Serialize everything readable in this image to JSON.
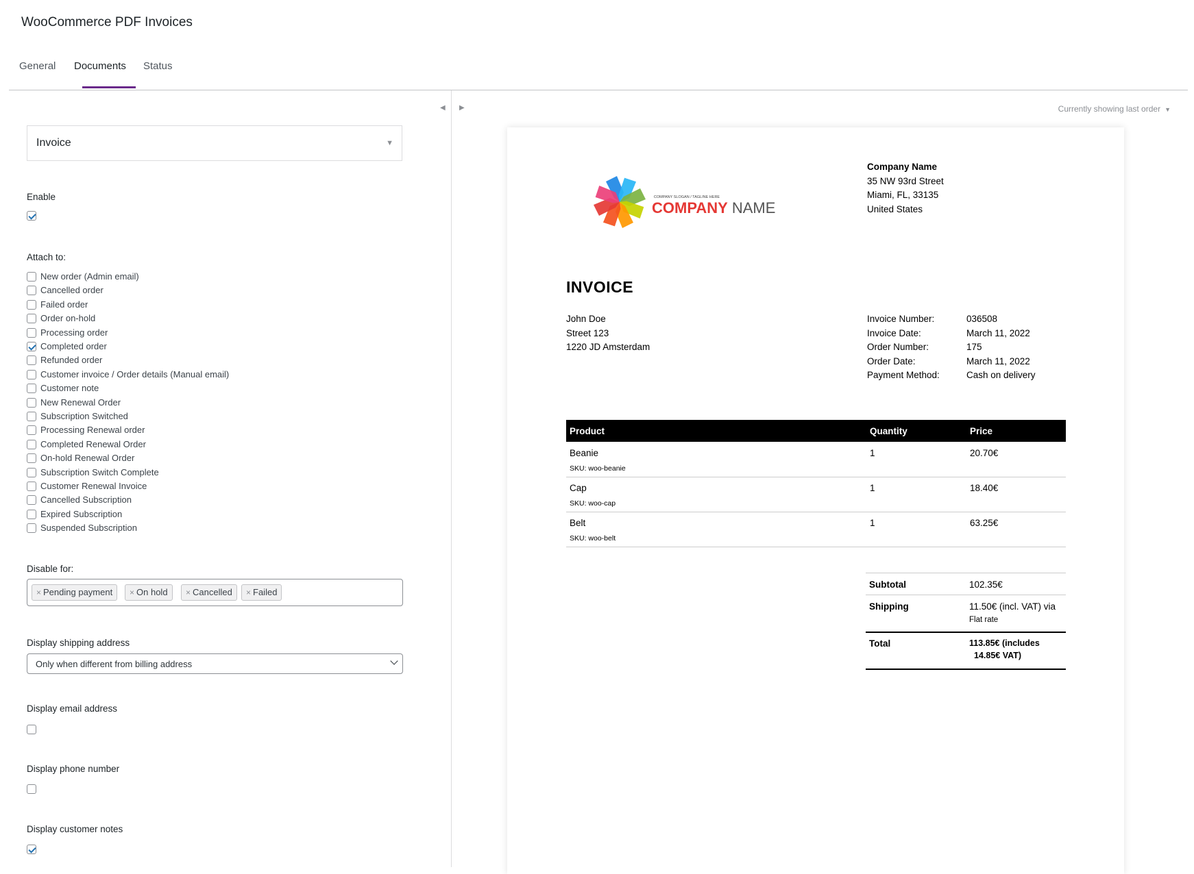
{
  "app_title": "WooCommerce PDF Invoices",
  "tabs": [
    {
      "label": "General"
    },
    {
      "label": "Documents"
    },
    {
      "label": "Status"
    }
  ],
  "settings": {
    "document_type": "Invoice",
    "enable_label": "Enable",
    "enable_checked": true,
    "attach_label": "Attach to:",
    "attach_options": [
      {
        "label": "New order (Admin email)",
        "checked": false
      },
      {
        "label": "Cancelled order",
        "checked": false
      },
      {
        "label": "Failed order",
        "checked": false
      },
      {
        "label": "Order on-hold",
        "checked": false
      },
      {
        "label": "Processing order",
        "checked": false
      },
      {
        "label": "Completed order",
        "checked": true
      },
      {
        "label": "Refunded order",
        "checked": false
      },
      {
        "label": "Customer invoice / Order details (Manual email)",
        "checked": false
      },
      {
        "label": "Customer note",
        "checked": false
      },
      {
        "label": "New Renewal Order",
        "checked": false
      },
      {
        "label": "Subscription Switched",
        "checked": false
      },
      {
        "label": "Processing Renewal order",
        "checked": false
      },
      {
        "label": "Completed Renewal Order",
        "checked": false
      },
      {
        "label": "On-hold Renewal Order",
        "checked": false
      },
      {
        "label": "Subscription Switch Complete",
        "checked": false
      },
      {
        "label": "Customer Renewal Invoice",
        "checked": false
      },
      {
        "label": "Cancelled Subscription",
        "checked": false
      },
      {
        "label": "Expired Subscription",
        "checked": false
      },
      {
        "label": "Suspended Subscription",
        "checked": false
      }
    ],
    "disable_label": "Disable for:",
    "disable_tags": [
      "Pending payment",
      "On hold",
      "Cancelled",
      "Failed"
    ],
    "tag_remove_glyph": "×",
    "shipping_label": "Display shipping address",
    "shipping_value": "Only when different from billing address",
    "email_label": "Display email address",
    "email_checked": false,
    "phone_label": "Display phone number",
    "phone_checked": false,
    "notes_label": "Display customer notes",
    "notes_checked": true
  },
  "preview": {
    "showing_label": "Currently showing last order",
    "logo": {
      "slogan": "COMPANY SLOGAN / TAGLINE HERE",
      "word1": "COMPANY",
      "word2": "NAME",
      "colors": [
        "#1e88e5",
        "#29b6f6",
        "#7cb342",
        "#c6d300",
        "#ff9800",
        "#f4511e",
        "#e53935",
        "#ec407a"
      ]
    },
    "company": {
      "name": "Company Name",
      "street": "35 NW 93rd Street",
      "city": "Miami, FL, 33135",
      "country": "United States"
    },
    "title": "INVOICE",
    "customer": {
      "name": "John Doe",
      "street": "Street 123",
      "city": "1220 JD Amsterdam"
    },
    "meta": [
      {
        "key": "Invoice Number:",
        "value": "036508"
      },
      {
        "key": "Invoice Date:",
        "value": "March 11, 2022"
      },
      {
        "key": "Order Number:",
        "value": "175"
      },
      {
        "key": "Order Date:",
        "value": "March 11, 2022"
      },
      {
        "key": "Payment Method:",
        "value": "Cash on delivery"
      }
    ],
    "table_headers": {
      "product": "Product",
      "quantity": "Quantity",
      "price": "Price"
    },
    "items": [
      {
        "name": "Beanie",
        "sku": "SKU:  woo-beanie",
        "qty": "1",
        "price": "20.70€"
      },
      {
        "name": "Cap",
        "sku": "SKU:  woo-cap",
        "qty": "1",
        "price": "18.40€"
      },
      {
        "name": "Belt",
        "sku": "SKU:  woo-belt",
        "qty": "1",
        "price": "63.25€"
      }
    ],
    "totals": {
      "subtotal_label": "Subtotal",
      "subtotal_value": "102.35€",
      "shipping_label": "Shipping",
      "shipping_value_1": "11.50€ (incl. VAT) via",
      "shipping_value_2": "Flat rate",
      "total_label": "Total",
      "total_value_1": "113.85€ (includes",
      "total_value_2": "14.85€ VAT)"
    }
  }
}
